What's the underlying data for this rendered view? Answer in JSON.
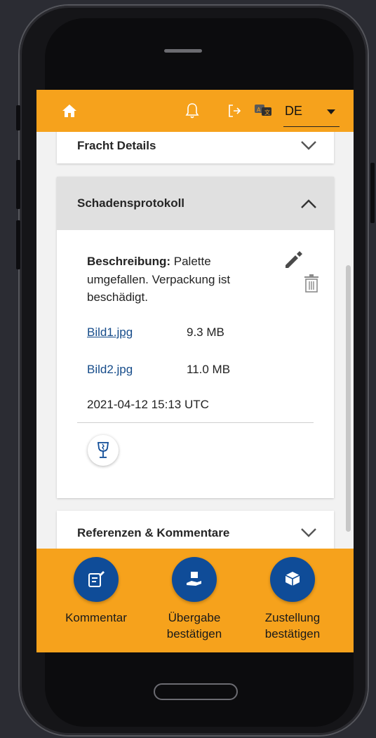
{
  "colors": {
    "accent": "#f6a21c",
    "primary": "#0f4c98",
    "link": "#164c8a"
  },
  "header": {
    "icons": [
      "home-icon",
      "bell-icon",
      "logout-icon",
      "language-icon"
    ],
    "language": "DE"
  },
  "sections": {
    "fracht": {
      "title": "Fracht Details",
      "expanded": false
    },
    "schaden": {
      "title": "Schadensprotokoll",
      "expanded": true,
      "description_label": "Beschreibung:",
      "description_text": " Palette umgefallen. Verpackung ist beschädigt.",
      "files": [
        {
          "name": "Bild1.jpg",
          "size": "9.3 MB"
        },
        {
          "name": "Bild2.jpg",
          "size": "11.0 MB"
        }
      ],
      "timestamp": "2021-04-12 15:13 UTC"
    },
    "referenzen": {
      "title": "Referenzen & Kommentare",
      "expanded": false
    }
  },
  "actions": [
    {
      "icon": "comment-icon",
      "label_line1": "Kommentar",
      "label_line2": ""
    },
    {
      "icon": "handover-icon",
      "label_line1": "Übergabe",
      "label_line2": "bestätigen"
    },
    {
      "icon": "delivery-icon",
      "label_line1": "Zustellung",
      "label_line2": "bestätigen"
    }
  ]
}
